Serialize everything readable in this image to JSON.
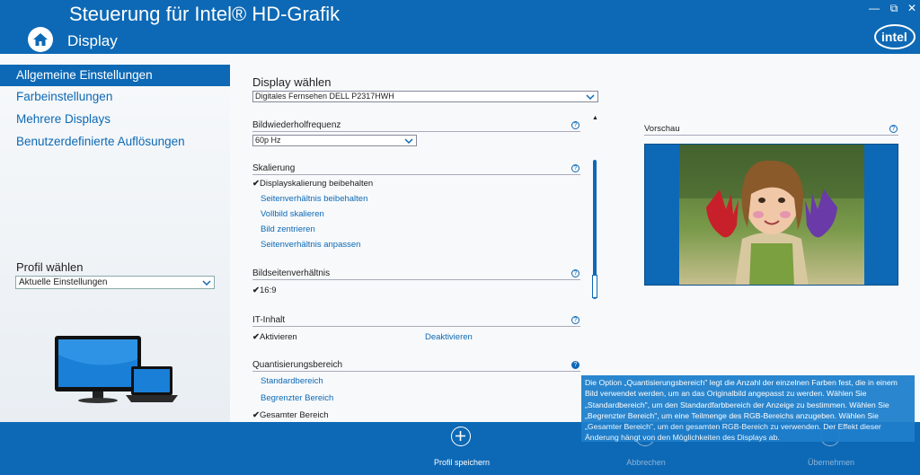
{
  "window": {
    "title": "Steuerung für Intel® HD-Grafik",
    "page": "Display",
    "controls": {
      "minimize": "—",
      "restore": "⧉",
      "close": "✕"
    }
  },
  "sidebar": {
    "items": [
      {
        "label": "Allgemeine Einstellungen",
        "active": true
      },
      {
        "label": "Farbeinstellungen"
      },
      {
        "label": "Mehrere Displays"
      },
      {
        "label": "Benutzerdefinierte Auflösungen"
      }
    ],
    "profile": {
      "label": "Profil wählen",
      "value": "Aktuelle Einstellungen"
    }
  },
  "display": {
    "heading": "Display wählen",
    "selected": "Digitales Fernsehen DELL P2317HWH"
  },
  "refresh": {
    "title": "Bildwiederholfrequenz",
    "value": "60p Hz"
  },
  "scaling": {
    "title": "Skalierung",
    "options": [
      "Displayskalierung beibehalten",
      "Seitenverhältnis beibehalten",
      "Vollbild skalieren",
      "Bild zentrieren",
      "Seitenverhältnis anpassen"
    ]
  },
  "aspect": {
    "title": "Bildseitenverhältnis",
    "value": "16:9"
  },
  "it_content": {
    "title": "IT-Inhalt",
    "activate": "Aktivieren",
    "deactivate": "Deaktivieren"
  },
  "quant": {
    "title": "Quantisierungsbereich",
    "options": [
      "Standardbereich",
      "Begrenzter Bereich",
      "Gesamter Bereich"
    ]
  },
  "preview": {
    "label": "Vorschau"
  },
  "tooltip": {
    "text": "Die Option „Quantisierungsbereich\" legt die Anzahl der einzelnen Farben fest, die in einem Bild verwendet werden, um an das Originalbild angepasst zu werden. Wählen Sie „Standardbereich\", um den Standardfarbbereich der Anzeige zu bestimmen. Wählen Sie „Begrenzter Bereich\", um eine Teilmenge des RGB-Bereichs anzugeben. Wählen Sie „Gesamter Bereich\", um den gesamten RGB-Bereich zu verwenden. Der Effekt dieser Änderung hängt von den Möglichkeiten des Displays ab."
  },
  "footer": {
    "save": "Profil speichern",
    "cancel": "Abbrechen",
    "apply": "Übernehmen"
  },
  "help_glyph": "?",
  "check_glyph": "✔",
  "colors": {
    "accent": "#0d69b5",
    "tooltip": "#1e7fcc"
  }
}
